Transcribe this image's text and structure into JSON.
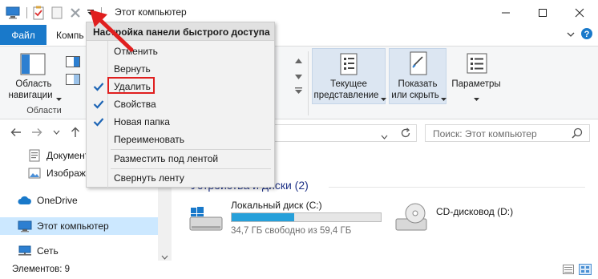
{
  "window": {
    "title": "Этот компьютер"
  },
  "ribbon_tabs": {
    "file": "Файл",
    "computer": "Компь"
  },
  "ribbon": {
    "nav_pane_label_line1": "Область",
    "nav_pane_label_line2": "навигации",
    "group_areas": "Области",
    "current_view_line1": "Текущее",
    "current_view_line2": "представление",
    "show_hide_line1": "Показать",
    "show_hide_line2": "или скрыть",
    "options": "Параметры"
  },
  "address": {
    "search_placeholder": "Поиск: Этот компьютер"
  },
  "nav_pane": {
    "items": [
      {
        "label": "Документ",
        "icon": "documents-icon"
      },
      {
        "label": "Изображ",
        "icon": "pictures-icon"
      },
      {
        "label": "OneDrive",
        "icon": "cloud-icon"
      },
      {
        "label": "Этот компьютер",
        "icon": "computer-icon",
        "selected": true
      },
      {
        "label": "Сеть",
        "icon": "network-icon"
      }
    ]
  },
  "main": {
    "group_header": "Устройства и диски (2)",
    "drives": [
      {
        "name": "Локальный диск (C:)",
        "free": "34,7 ГБ свободно из 59,4 ГБ",
        "used_fraction": 0.42
      },
      {
        "name": "CD-дисковод (D:)"
      }
    ]
  },
  "status": {
    "items_count": "Элементов: 9"
  },
  "menu": {
    "header": "Настройка панели быстрого доступа",
    "items": [
      {
        "label": "Отменить",
        "checked": false
      },
      {
        "label": "Вернуть",
        "checked": false
      },
      {
        "label": "Удалить",
        "checked": true,
        "highlighted_red": true
      },
      {
        "label": "Свойства",
        "checked": true
      },
      {
        "label": "Новая папка",
        "checked": true
      },
      {
        "label": "Переименовать",
        "checked": false
      },
      {
        "label": "Разместить под лентой",
        "checked": false
      },
      {
        "label": "Свернуть ленту",
        "checked": false
      }
    ]
  },
  "colors": {
    "accent": "#1979ca",
    "selection": "#cce8ff",
    "annotation_red": "#e01f1f",
    "group_header": "#1e3287"
  }
}
